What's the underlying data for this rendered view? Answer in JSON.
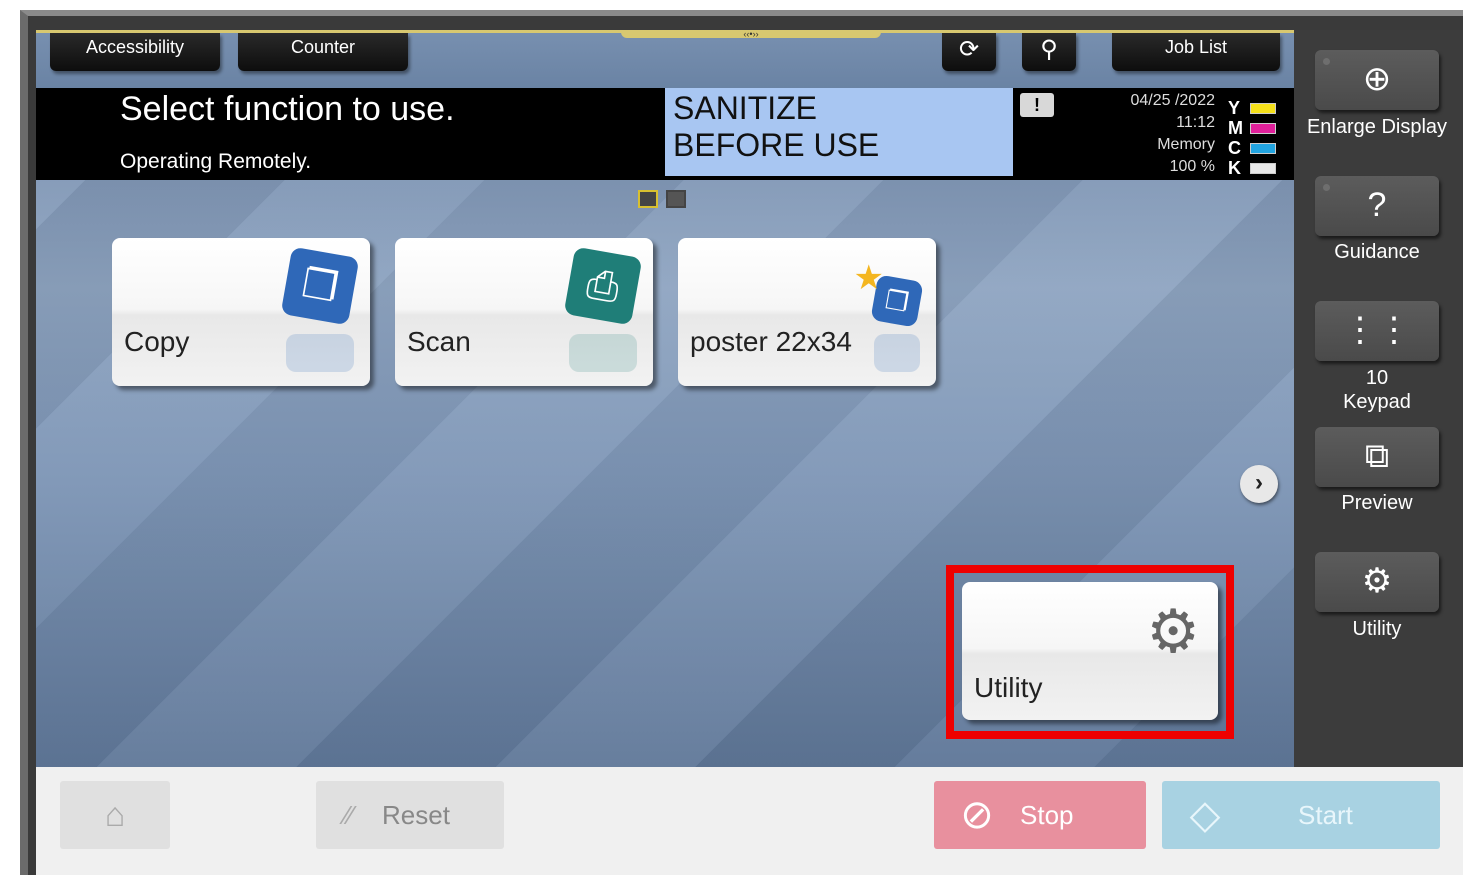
{
  "tabs": {
    "accessibility": "Accessibility",
    "counter": "Counter",
    "job_list": "Job List"
  },
  "header": {
    "title": "Select function to use.",
    "subtitle": "Operating Remotely.",
    "notice_line1": "SANITIZE",
    "notice_line2": "BEFORE USE",
    "date": "04/25 /2022",
    "time": "11:12",
    "memory_label": "Memory",
    "memory_value": "100 %",
    "toner": [
      {
        "letter": "Y",
        "color": "#f5e01a"
      },
      {
        "letter": "M",
        "color": "#e0209a"
      },
      {
        "letter": "C",
        "color": "#22a4e0"
      },
      {
        "letter": "K",
        "color": "#e8e8e8"
      }
    ]
  },
  "tiles": [
    {
      "label": "Copy",
      "icon": "copy-icon",
      "color": "#2f68b8"
    },
    {
      "label": "Scan",
      "icon": "scan-icon",
      "color": "#1f7e78"
    },
    {
      "label": "poster  22x34",
      "icon": "favorite-copy-icon",
      "color": "#2f68b8"
    },
    {
      "label": "Utility",
      "icon": "gear-icon",
      "color": "#666666"
    }
  ],
  "sidebar": {
    "enlarge": "Enlarge Display",
    "guidance": "Guidance",
    "keypad_line1": "10",
    "keypad_line2": "Keypad",
    "preview": "Preview",
    "utility": "Utility"
  },
  "bottom": {
    "reset": "Reset",
    "stop": "Stop",
    "start": "Start"
  },
  "highlight_color": "#ee0000"
}
